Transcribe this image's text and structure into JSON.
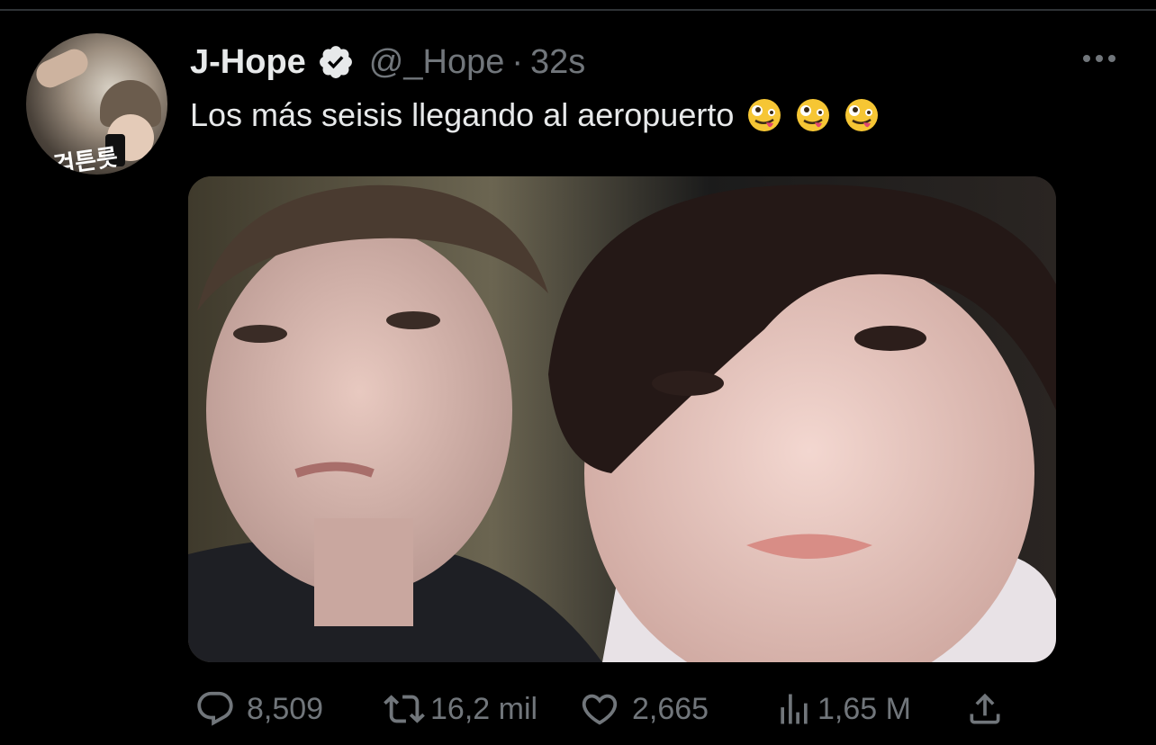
{
  "tweet": {
    "display_name": "J-Hope",
    "handle": "@_Hope",
    "separator": "·",
    "timestamp": "32s",
    "text": "Los más seisis llegando al aeropuerto",
    "avatar_scribble": "걱튼릇"
  },
  "icons": {
    "verified": "verified-badge-icon",
    "more": "more-dots-icon",
    "emoji": "zany-face-emoji",
    "reply": "reply-icon",
    "retweet": "retweet-icon",
    "like": "heart-icon",
    "views": "views-chart-icon",
    "share": "share-icon"
  },
  "actions": {
    "reply_count": "8,509",
    "retweet_count": "16,2 mil",
    "like_count": "2,665",
    "views_count": "1,65 M"
  },
  "colors": {
    "background": "#000000",
    "text": "#e7e9ea",
    "secondary": "#71767b",
    "emoji": "#f6c634"
  }
}
